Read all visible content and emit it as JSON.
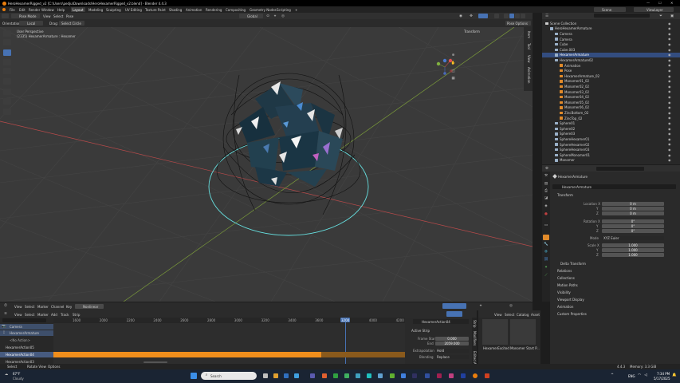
{
  "window": {
    "title": "HeroHexamerRigged_v2 [C:\\Users\\pedju\\Downloads\\HeroHexamerRigged_v2.blend] - Blender 4.4.3"
  },
  "menu": [
    "File",
    "Edit",
    "Render",
    "Window",
    "Help"
  ],
  "workspaces": [
    "Layout",
    "Modeling",
    "Sculpting",
    "UV Editing",
    "Texture Paint",
    "Shading",
    "Animation",
    "Rendering",
    "Compositing",
    "Geometry Nodes",
    "Scripting"
  ],
  "workspace_add": "+",
  "scene": {
    "label": "Scene",
    "view_layer": "ViewLayer"
  },
  "viewport": {
    "mode": "Pose Mode",
    "menus": [
      "View",
      "Select",
      "Pose"
    ],
    "orientation_label": "Orientation:",
    "orientation_value": "Local",
    "drag_label": "Drag:",
    "drag_value": "Select Circle",
    "transform_space": "Global",
    "overlay_title": "User Perspective",
    "overlay_sub": "(2335) HexamerArmature : Hexamer",
    "pose_options": "Pose Options",
    "transform_panel": "Transform",
    "side_tabs": [
      "Item",
      "Tool",
      "View",
      "Animation"
    ]
  },
  "outliner": {
    "search_placeholder": "",
    "items": [
      {
        "label": "Scene Collection",
        "indent": 0
      },
      {
        "label": "HeroHexamerArmature",
        "indent": 1
      },
      {
        "label": "Camera",
        "indent": 2
      },
      {
        "label": "Camera",
        "indent": 2
      },
      {
        "label": "Cube",
        "indent": 2
      },
      {
        "label": "Cube.003",
        "indent": 2
      },
      {
        "label": "HexamerArmature",
        "indent": 2,
        "selected": true
      },
      {
        "label": "HexamerArmature02",
        "indent": 2
      },
      {
        "label": "Animation",
        "indent": 3
      },
      {
        "label": "Pose",
        "indent": 3
      },
      {
        "label": "HexamerArmature_02",
        "indent": 3
      },
      {
        "label": "Monomer01_02",
        "indent": 3
      },
      {
        "label": "Monomer02_02",
        "indent": 3
      },
      {
        "label": "Monomer03_02",
        "indent": 3
      },
      {
        "label": "Monomer04_02",
        "indent": 3
      },
      {
        "label": "Monomer05_02",
        "indent": 3
      },
      {
        "label": "Monomer06_02",
        "indent": 3
      },
      {
        "label": "ZincBottom_02",
        "indent": 3
      },
      {
        "label": "ZincTop_02",
        "indent": 3
      },
      {
        "label": "Sphere01",
        "indent": 2
      },
      {
        "label": "Sphere02",
        "indent": 2
      },
      {
        "label": "Sphere03",
        "indent": 2
      },
      {
        "label": "SphereHexamer01",
        "indent": 2
      },
      {
        "label": "SphereHexamer02",
        "indent": 2
      },
      {
        "label": "SphereHexamer03",
        "indent": 2
      },
      {
        "label": "SphereMonomer01",
        "indent": 2
      },
      {
        "label": "Monomer",
        "indent": 2
      }
    ]
  },
  "properties": {
    "object_name": "HexamerArmature",
    "object_name2": "HexamerArmature",
    "transform_header": "Transform",
    "location_label": "Location X",
    "loc": [
      "0 m",
      "0 m",
      "0 m"
    ],
    "rotation_label": "Rotation X",
    "rot": [
      "0°",
      "0°",
      "0°"
    ],
    "mode_label": "Mode",
    "mode_value": "XYZ Euler",
    "scale_label": "Scale X",
    "scale": [
      "1.000",
      "1.000",
      "1.000"
    ],
    "axis": [
      "Y",
      "Z"
    ],
    "sections": [
      "Delta Transform",
      "Relations",
      "Collections",
      "Motion Paths",
      "Visibility",
      "Viewport Display",
      "Animation",
      "Custom Properties"
    ]
  },
  "nla": {
    "menus": [
      "View",
      "Select",
      "Marker",
      "Channel",
      "Key"
    ],
    "mode": "Nonlinear",
    "menus2": [
      "View",
      "Select",
      "Marker",
      "Add",
      "Track",
      "Strip"
    ],
    "frames": [
      "1600",
      "2000",
      "2200",
      "2400",
      "2600",
      "2800",
      "3000",
      "3200",
      "3400",
      "3600",
      "3800",
      "4000",
      "4200"
    ],
    "playhead": "3200",
    "tracks": [
      "Camera",
      "HexamerArmature",
      "<No Action>",
      "HexamerAction05",
      "HexamerAction04",
      "HexamerAction03"
    ],
    "strip_panel": {
      "action": "HexamerAction04",
      "header": "Active Strip",
      "frame_start_label": "Frame Start",
      "frame_start": "0.000",
      "end_label": "End",
      "end": "2059.000",
      "extrapolation_label": "Extrapolation",
      "extrapolation": "Hold",
      "blending_label": "Blending",
      "blending": "Replace"
    },
    "side_tabs": [
      "Strip",
      "Modifiers",
      "Edited Action"
    ]
  },
  "asset_browser": {
    "menus": [
      "View",
      "Select",
      "Catalog",
      "Asset"
    ],
    "assets": [
      "HexamerExcited",
      "Monomer Start P..."
    ]
  },
  "status_bar": {
    "left": [
      "Select",
      "Rotate View",
      "Options"
    ],
    "version": "4.4.3",
    "memory": "Memory: 3.3 GiB"
  },
  "taskbar": {
    "weather_temp": "67°F",
    "weather_desc": "Cloudy",
    "search": "Search",
    "lang": "ENG",
    "time": "7:34 PM",
    "date": "5/17/2025"
  },
  "colors": {
    "accent": "#4772b3",
    "selected_row": "#334d80",
    "strip": "#f08e1c",
    "playhead": "#4772b3",
    "teal_circle": "#66e0e0"
  }
}
